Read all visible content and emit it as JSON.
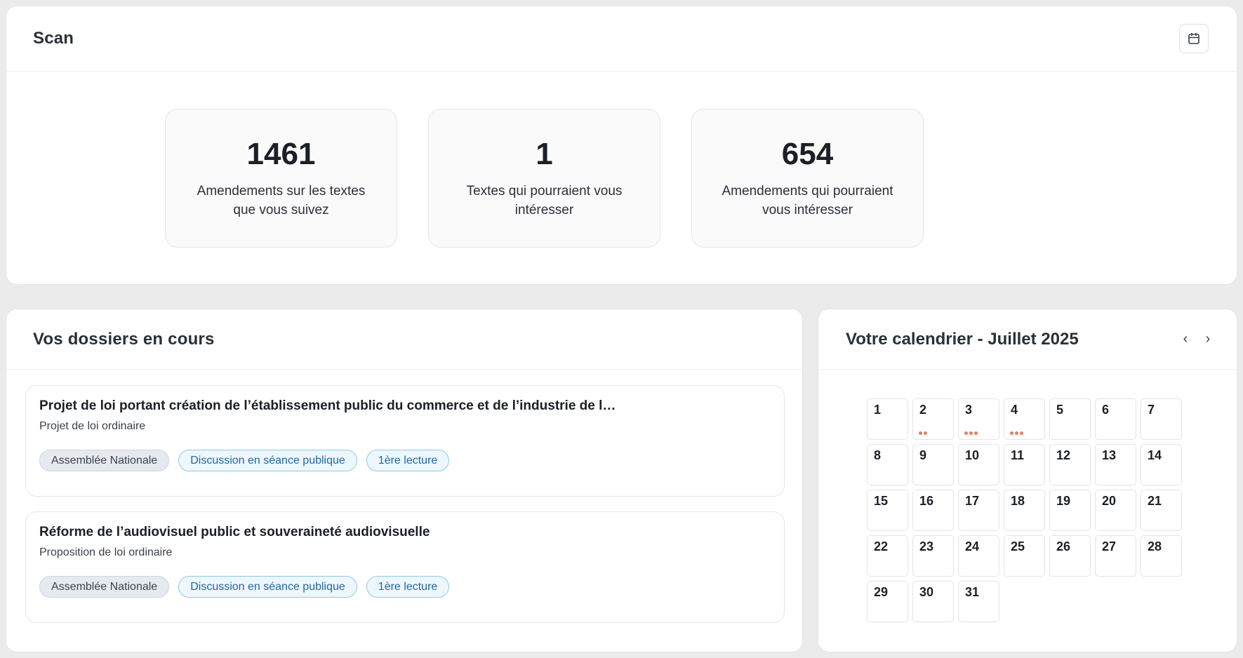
{
  "scan": {
    "title": "Scan",
    "calendar_icon": "calendar-icon",
    "stats": [
      {
        "value": "1461",
        "label": "Amendements sur les textes que vous suivez"
      },
      {
        "value": "1",
        "label": "Textes qui pourraient vous intéresser"
      },
      {
        "value": "654",
        "label": "Amendements qui pourraient vous intéresser"
      }
    ]
  },
  "dossiers": {
    "title": "Vos dossiers en cours",
    "items": [
      {
        "title": "Projet de loi portant création de l’établissement public du commerce et de l’industrie de l…",
        "type": "Projet de loi ordinaire",
        "tags": [
          "Assemblée Nationale",
          "Discussion en séance publique",
          "1ère lecture"
        ]
      },
      {
        "title": "Réforme de l’audiovisuel public et souveraineté audiovisuelle",
        "type": "Proposition de loi ordinaire",
        "tags": [
          "Assemblée Nationale",
          "Discussion en séance publique",
          "1ère lecture"
        ]
      }
    ]
  },
  "calendar": {
    "title": "Votre calendrier - Juillet 2025",
    "prev_icon": "chevron-left-icon",
    "next_icon": "chevron-right-icon",
    "prev_label": "‹",
    "next_label": "›",
    "days": [
      "1",
      "2",
      "3",
      "4",
      "5",
      "6",
      "7",
      "8",
      "9",
      "10",
      "11",
      "12",
      "13",
      "14",
      "15",
      "16",
      "17",
      "18",
      "19",
      "20",
      "21",
      "22",
      "23",
      "24",
      "25",
      "26",
      "27",
      "28",
      "29",
      "30",
      "31"
    ],
    "event_dots": {
      "2": 2,
      "3": 3,
      "4": 3
    },
    "dot_color": "#f07a55"
  },
  "colors": {
    "tag_grey_bg": "#e6e9ef",
    "tag_blue_text": "#1e67a6",
    "tag_blue_border": "#8ec9ec"
  }
}
